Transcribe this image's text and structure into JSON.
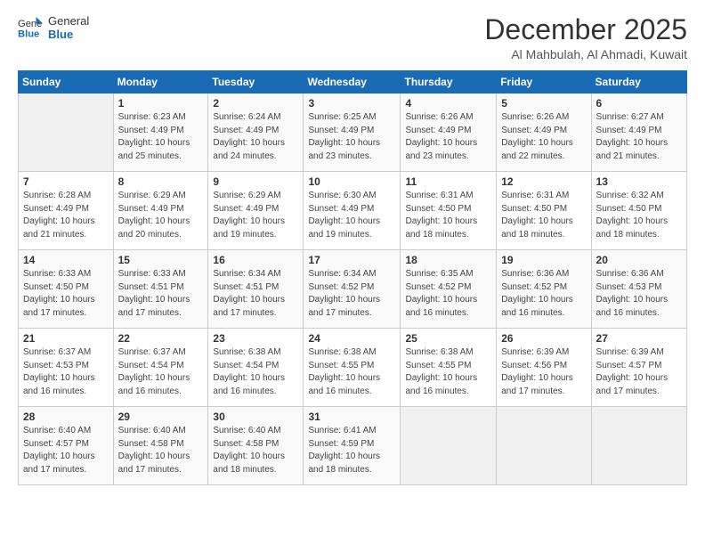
{
  "logo": {
    "general": "General",
    "blue": "Blue"
  },
  "title": {
    "month_year": "December 2025",
    "location": "Al Mahbulah, Al Ahmadi, Kuwait"
  },
  "header": {
    "days": [
      "Sunday",
      "Monday",
      "Tuesday",
      "Wednesday",
      "Thursday",
      "Friday",
      "Saturday"
    ]
  },
  "weeks": [
    [
      {
        "day": "",
        "sunrise": "",
        "sunset": "",
        "daylight": ""
      },
      {
        "day": "1",
        "sunrise": "Sunrise: 6:23 AM",
        "sunset": "Sunset: 4:49 PM",
        "daylight": "Daylight: 10 hours and 25 minutes."
      },
      {
        "day": "2",
        "sunrise": "Sunrise: 6:24 AM",
        "sunset": "Sunset: 4:49 PM",
        "daylight": "Daylight: 10 hours and 24 minutes."
      },
      {
        "day": "3",
        "sunrise": "Sunrise: 6:25 AM",
        "sunset": "Sunset: 4:49 PM",
        "daylight": "Daylight: 10 hours and 23 minutes."
      },
      {
        "day": "4",
        "sunrise": "Sunrise: 6:26 AM",
        "sunset": "Sunset: 4:49 PM",
        "daylight": "Daylight: 10 hours and 23 minutes."
      },
      {
        "day": "5",
        "sunrise": "Sunrise: 6:26 AM",
        "sunset": "Sunset: 4:49 PM",
        "daylight": "Daylight: 10 hours and 22 minutes."
      },
      {
        "day": "6",
        "sunrise": "Sunrise: 6:27 AM",
        "sunset": "Sunset: 4:49 PM",
        "daylight": "Daylight: 10 hours and 21 minutes."
      }
    ],
    [
      {
        "day": "7",
        "sunrise": "Sunrise: 6:28 AM",
        "sunset": "Sunset: 4:49 PM",
        "daylight": "Daylight: 10 hours and 21 minutes."
      },
      {
        "day": "8",
        "sunrise": "Sunrise: 6:29 AM",
        "sunset": "Sunset: 4:49 PM",
        "daylight": "Daylight: 10 hours and 20 minutes."
      },
      {
        "day": "9",
        "sunrise": "Sunrise: 6:29 AM",
        "sunset": "Sunset: 4:49 PM",
        "daylight": "Daylight: 10 hours and 19 minutes."
      },
      {
        "day": "10",
        "sunrise": "Sunrise: 6:30 AM",
        "sunset": "Sunset: 4:49 PM",
        "daylight": "Daylight: 10 hours and 19 minutes."
      },
      {
        "day": "11",
        "sunrise": "Sunrise: 6:31 AM",
        "sunset": "Sunset: 4:50 PM",
        "daylight": "Daylight: 10 hours and 18 minutes."
      },
      {
        "day": "12",
        "sunrise": "Sunrise: 6:31 AM",
        "sunset": "Sunset: 4:50 PM",
        "daylight": "Daylight: 10 hours and 18 minutes."
      },
      {
        "day": "13",
        "sunrise": "Sunrise: 6:32 AM",
        "sunset": "Sunset: 4:50 PM",
        "daylight": "Daylight: 10 hours and 18 minutes."
      }
    ],
    [
      {
        "day": "14",
        "sunrise": "Sunrise: 6:33 AM",
        "sunset": "Sunset: 4:50 PM",
        "daylight": "Daylight: 10 hours and 17 minutes."
      },
      {
        "day": "15",
        "sunrise": "Sunrise: 6:33 AM",
        "sunset": "Sunset: 4:51 PM",
        "daylight": "Daylight: 10 hours and 17 minutes."
      },
      {
        "day": "16",
        "sunrise": "Sunrise: 6:34 AM",
        "sunset": "Sunset: 4:51 PM",
        "daylight": "Daylight: 10 hours and 17 minutes."
      },
      {
        "day": "17",
        "sunrise": "Sunrise: 6:34 AM",
        "sunset": "Sunset: 4:52 PM",
        "daylight": "Daylight: 10 hours and 17 minutes."
      },
      {
        "day": "18",
        "sunrise": "Sunrise: 6:35 AM",
        "sunset": "Sunset: 4:52 PM",
        "daylight": "Daylight: 10 hours and 16 minutes."
      },
      {
        "day": "19",
        "sunrise": "Sunrise: 6:36 AM",
        "sunset": "Sunset: 4:52 PM",
        "daylight": "Daylight: 10 hours and 16 minutes."
      },
      {
        "day": "20",
        "sunrise": "Sunrise: 6:36 AM",
        "sunset": "Sunset: 4:53 PM",
        "daylight": "Daylight: 10 hours and 16 minutes."
      }
    ],
    [
      {
        "day": "21",
        "sunrise": "Sunrise: 6:37 AM",
        "sunset": "Sunset: 4:53 PM",
        "daylight": "Daylight: 10 hours and 16 minutes."
      },
      {
        "day": "22",
        "sunrise": "Sunrise: 6:37 AM",
        "sunset": "Sunset: 4:54 PM",
        "daylight": "Daylight: 10 hours and 16 minutes."
      },
      {
        "day": "23",
        "sunrise": "Sunrise: 6:38 AM",
        "sunset": "Sunset: 4:54 PM",
        "daylight": "Daylight: 10 hours and 16 minutes."
      },
      {
        "day": "24",
        "sunrise": "Sunrise: 6:38 AM",
        "sunset": "Sunset: 4:55 PM",
        "daylight": "Daylight: 10 hours and 16 minutes."
      },
      {
        "day": "25",
        "sunrise": "Sunrise: 6:38 AM",
        "sunset": "Sunset: 4:55 PM",
        "daylight": "Daylight: 10 hours and 16 minutes."
      },
      {
        "day": "26",
        "sunrise": "Sunrise: 6:39 AM",
        "sunset": "Sunset: 4:56 PM",
        "daylight": "Daylight: 10 hours and 17 minutes."
      },
      {
        "day": "27",
        "sunrise": "Sunrise: 6:39 AM",
        "sunset": "Sunset: 4:57 PM",
        "daylight": "Daylight: 10 hours and 17 minutes."
      }
    ],
    [
      {
        "day": "28",
        "sunrise": "Sunrise: 6:40 AM",
        "sunset": "Sunset: 4:57 PM",
        "daylight": "Daylight: 10 hours and 17 minutes."
      },
      {
        "day": "29",
        "sunrise": "Sunrise: 6:40 AM",
        "sunset": "Sunset: 4:58 PM",
        "daylight": "Daylight: 10 hours and 17 minutes."
      },
      {
        "day": "30",
        "sunrise": "Sunrise: 6:40 AM",
        "sunset": "Sunset: 4:58 PM",
        "daylight": "Daylight: 10 hours and 18 minutes."
      },
      {
        "day": "31",
        "sunrise": "Sunrise: 6:41 AM",
        "sunset": "Sunset: 4:59 PM",
        "daylight": "Daylight: 10 hours and 18 minutes."
      },
      {
        "day": "",
        "sunrise": "",
        "sunset": "",
        "daylight": ""
      },
      {
        "day": "",
        "sunrise": "",
        "sunset": "",
        "daylight": ""
      },
      {
        "day": "",
        "sunrise": "",
        "sunset": "",
        "daylight": ""
      }
    ]
  ]
}
